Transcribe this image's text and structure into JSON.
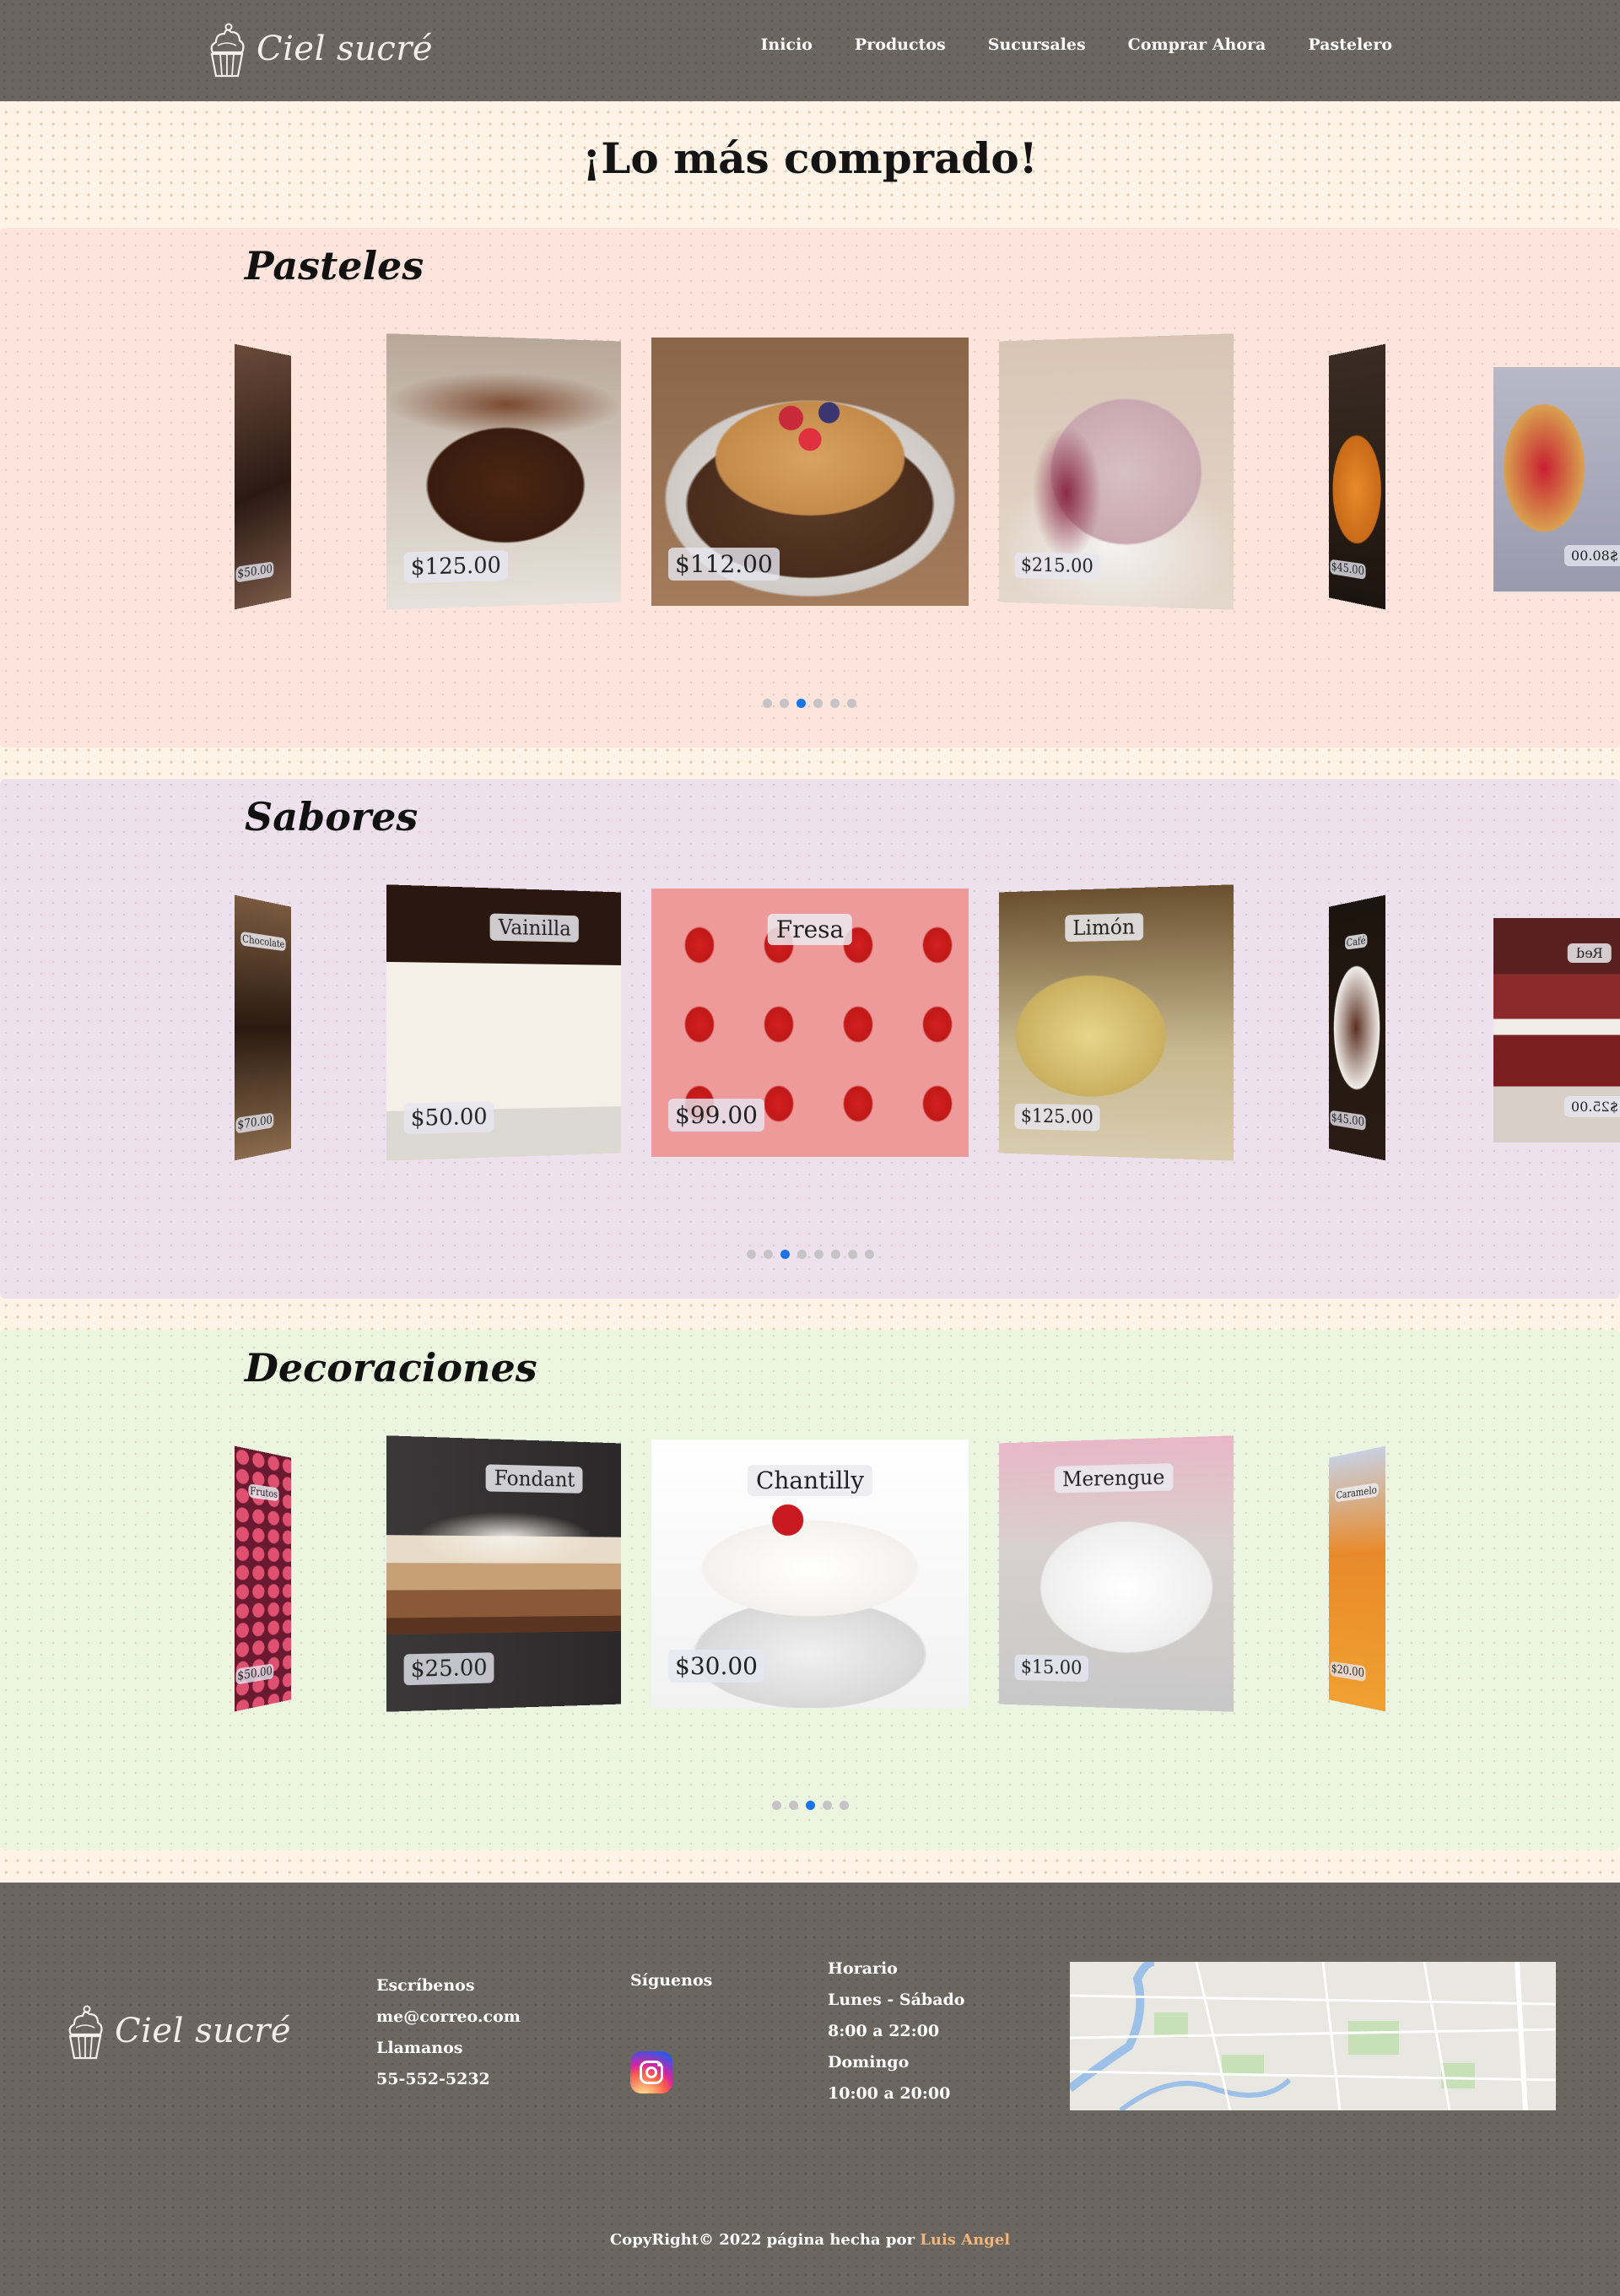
{
  "header": {
    "brand": "Ciel sucré",
    "nav": [
      "Inicio",
      "Productos",
      "Sucursales",
      "Comprar Ahora",
      "Pastelero"
    ]
  },
  "main_title": "¡Lo más comprado!",
  "sections": [
    {
      "title": "Pasteles",
      "slides": {
        "far_left": {
          "price": "$50.00"
        },
        "left": {
          "price": "$125.00"
        },
        "center": {
          "price": "$112.00"
        },
        "right": {
          "price": "$215.00"
        },
        "far_right": {
          "price": "$45.00"
        },
        "extra": {
          "price": "$80.00"
        }
      },
      "dot_count": 6,
      "active_dot": 2
    },
    {
      "title": "Sabores",
      "slides": {
        "far_left": {
          "name": "Chocolate",
          "price": "$70.00"
        },
        "left": {
          "name": "Vainilla",
          "price": "$50.00"
        },
        "center": {
          "name": "Fresa",
          "price": "$99.00"
        },
        "right": {
          "name": "Limón",
          "price": "$125.00"
        },
        "far_right": {
          "name": "Café",
          "price": "$45.00"
        },
        "extra": {
          "name": "Red",
          "price": "$25.00"
        }
      },
      "dot_count": 8,
      "active_dot": 2
    },
    {
      "title": "Decoraciones",
      "slides": {
        "far_left": {
          "name": "Frutos",
          "price": "$50.00"
        },
        "left": {
          "name": "Fondant",
          "price": "$25.00"
        },
        "center": {
          "name": "Chantilly",
          "price": "$30.00"
        },
        "right": {
          "name": "Merengue",
          "price": "$15.00"
        },
        "far_right": {
          "name": "Caramelo",
          "price": "$20.00"
        }
      },
      "dot_count": 5,
      "active_dot": 2
    }
  ],
  "footer": {
    "brand": "Ciel sucré",
    "contact": [
      "Escríbenos",
      "me@correo.com",
      "Llamanos",
      "55-552-5232"
    ],
    "social_title": "Síguenos",
    "social_icon": "instagram-icon",
    "hours": [
      "Horario",
      "Lunes - Sábado",
      "8:00 a 22:00",
      "Domingo",
      "10:00 a 20:00"
    ],
    "copyright_text": "CopyRight© 2022 página hecha por ",
    "copyright_author": "Luis Angel"
  },
  "colors": {
    "header_bg": "#6b6660",
    "section_pasteles": "#fde4dc",
    "section_sabores": "#eee1ee",
    "section_decoraciones": "#ecf5e0",
    "active_dot": "#1a73e8",
    "author_link": "#f0b57a"
  }
}
